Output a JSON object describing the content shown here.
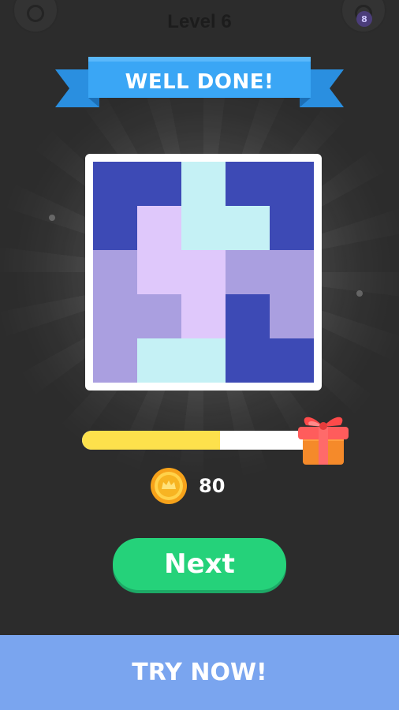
{
  "header": {
    "level_label": "Level 6",
    "left_button_icon": "settings-icon",
    "right_button_icon": "hint-icon",
    "right_badge": "8"
  },
  "banner": {
    "title": "WELL DONE!"
  },
  "puzzle": {
    "grid_size": 5,
    "palette": {
      "navy": "#3d4ab5",
      "periwinkle": "#aa9fe0",
      "lavender": "#dfc8fb",
      "cyan": "#c5f1f5"
    },
    "cells": [
      [
        "navy",
        "navy",
        "cyan",
        "navy",
        "navy"
      ],
      [
        "navy",
        "lavender",
        "cyan",
        "cyan",
        "navy"
      ],
      [
        "periwinkle",
        "lavender",
        "lavender",
        "periwinkle",
        "periwinkle"
      ],
      [
        "periwinkle",
        "periwinkle",
        "lavender",
        "navy",
        "periwinkle"
      ],
      [
        "periwinkle",
        "cyan",
        "cyan",
        "navy",
        "navy"
      ]
    ]
  },
  "progress": {
    "fraction": 0.6,
    "fill_color": "#fde14c",
    "reward_icon": "gift-box-icon"
  },
  "coins": {
    "icon": "coin-icon",
    "value": "80"
  },
  "next_button": {
    "label": "Next",
    "color": "#25d27a"
  },
  "ad_banner": {
    "label": "TRY NOW!",
    "color": "#7aa5ef"
  }
}
